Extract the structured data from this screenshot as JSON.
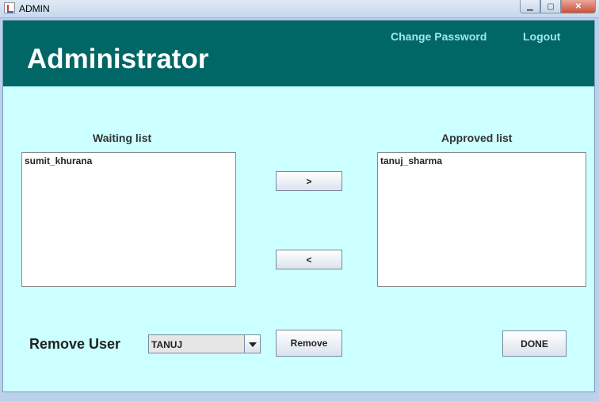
{
  "window": {
    "title": "ADMIN",
    "icons": {
      "app": "java-cup-icon",
      "minimize": "minimize-icon",
      "maximize": "maximize-icon",
      "close": "close-icon"
    }
  },
  "header": {
    "title": "Administrator",
    "change_password": "Change Password",
    "logout": "Logout"
  },
  "waiting": {
    "label": "Waiting list",
    "items": [
      "sumit_khurana"
    ]
  },
  "approved": {
    "label": "Approved list",
    "items": [
      "tanuj_sharma"
    ]
  },
  "buttons": {
    "approve": ">",
    "unapprove": "<",
    "remove": "Remove",
    "done": "DONE"
  },
  "remove_user": {
    "label": "Remove User",
    "selected": "TANUJ"
  },
  "colors": {
    "header_bg": "#006666",
    "content_bg": "#ccffff",
    "link": "#9fe8e8"
  }
}
